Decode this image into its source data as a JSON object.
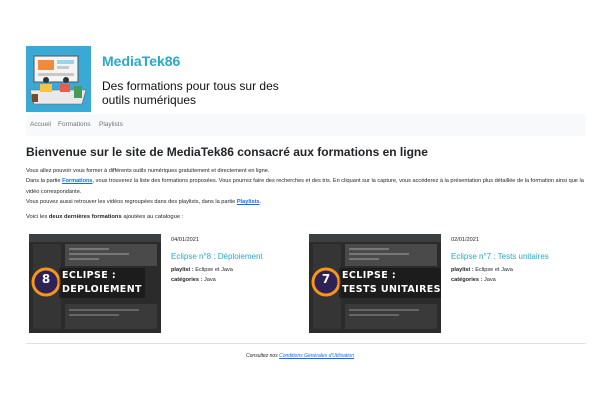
{
  "brand": {
    "title": "MediaTek86",
    "tagline": "Des formations pour tous sur des outils numériques"
  },
  "nav": {
    "items": [
      {
        "label": "Accueil"
      },
      {
        "label": "Formations"
      },
      {
        "label": "Playlists"
      }
    ]
  },
  "main": {
    "title": "Bienvenue sur le site de MediaTek86 consacré aux formations en ligne",
    "intro_line1": "Vous allez pouvoir vous former à différents outils numériques gratuitement et directement en ligne.",
    "intro_line2_before": "Dans la partie ",
    "intro_line2_link": "Formations",
    "intro_line2_after": ", vous trouverez la liste des formations proposées. Vous pourrez faire des recherches et des tris. En cliquant sur la capture, vous accéderez à la présentation plus détaillée de la formation ainsi que la vidéo correspondante.",
    "intro_line3_before": "Vous pouvez aussi retrouver les vidéos regroupées dans des playlists, dans la partie ",
    "intro_line3_link": "Playlists",
    "intro_line3_after": ".",
    "latest_before": "Voici les ",
    "latest_bold": "deux dernières formations",
    "latest_after": " ajoutées au catalogue :"
  },
  "formations": [
    {
      "date": "04/01/2021",
      "title": "Eclipse n°8 : Déploiement",
      "playlist_label": "playlist :",
      "playlist": "Eclipse et Java",
      "categories_label": "catégories :",
      "categories": "Java",
      "thumb_line1": "ECLIPSE :",
      "thumb_line2": "DEPLOIEMENT",
      "badge": "8"
    },
    {
      "date": "02/01/2021",
      "title": "Eclipse n°7 : Tests unitaires",
      "playlist_label": "playlist :",
      "playlist": "Eclipse et Java",
      "categories_label": "catégories :",
      "categories": "Java",
      "thumb_line1": "ECLIPSE :",
      "thumb_line2": "TESTS UNITAIRES",
      "badge": "7"
    }
  ],
  "footer": {
    "before": "Consultez nos ",
    "link": "Conditions Générales d'Utilisation"
  },
  "colors": {
    "accent": "#27a9cf",
    "link": "#0d6efd",
    "logo_bg": "#3aa9d6",
    "nav_bg": "#f8f9fa"
  }
}
